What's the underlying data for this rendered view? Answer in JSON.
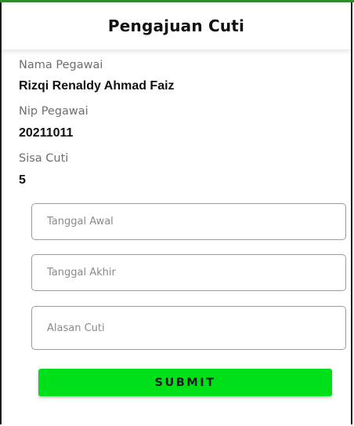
{
  "header": {
    "title": "Pengajuan Cuti"
  },
  "employee": {
    "name_label": "Nama Pegawai",
    "name_value": "Rizqi Renaldy Ahmad Faiz",
    "nip_label": "Nip Pegawai",
    "nip_value": "20211011",
    "leave_label": "Sisa Cuti",
    "leave_value": "5"
  },
  "form": {
    "start_date": {
      "value": "",
      "placeholder": "Tanggal Awal"
    },
    "end_date": {
      "value": "",
      "placeholder": "Tanggal Akhir"
    },
    "reason": {
      "value": "",
      "placeholder": "Alasan Cuti"
    },
    "submit_label": "SUBMIT"
  },
  "colors": {
    "accent_top": "#2e8b2e",
    "submit_button": "#00e01a"
  }
}
